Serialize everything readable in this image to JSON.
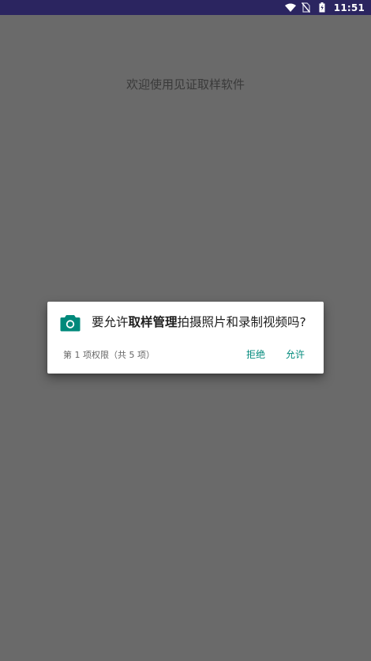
{
  "status_bar": {
    "time": "11:51",
    "icons": [
      "wifi-icon",
      "no-sim-icon",
      "battery-charging-icon"
    ]
  },
  "app": {
    "welcome_text": "欢迎使用见证取样软件"
  },
  "permission_dialog": {
    "icon": "camera-icon",
    "message_prefix": "要允许",
    "app_name": "取样管理",
    "message_suffix": "拍摄照片和录制视频吗?",
    "counter": "第 1 项权限（共 5 项）",
    "deny_label": "拒绝",
    "allow_label": "允许"
  },
  "colors": {
    "status_bar": "#2b2560",
    "scrim_background": "#6a6a6a",
    "accent": "#00897b"
  }
}
